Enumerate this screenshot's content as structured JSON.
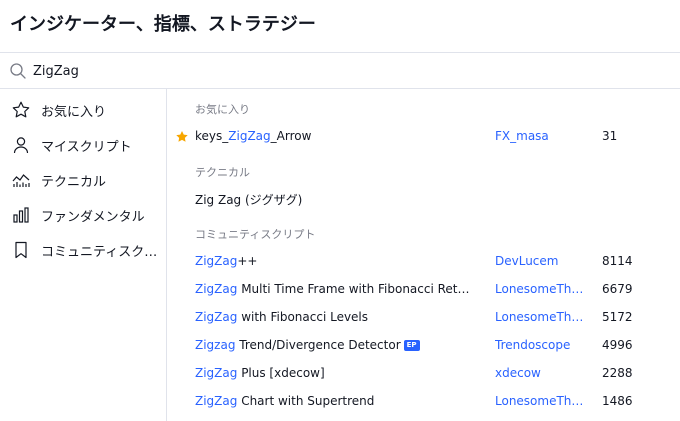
{
  "header": {
    "title": "インジケーター、指標、ストラテジー"
  },
  "search": {
    "value": "ZigZag"
  },
  "sidebar": {
    "items": [
      {
        "label": "お気に入り",
        "icon": "star-outline-icon"
      },
      {
        "label": "マイスクリプト",
        "icon": "user-icon"
      },
      {
        "label": "テクニカル",
        "icon": "technicals-chart-icon"
      },
      {
        "label": "ファンダメンタル",
        "icon": "bar-chart-icon"
      },
      {
        "label": "コミュニティスクリ...",
        "icon": "bookmark-icon"
      }
    ]
  },
  "sections": {
    "favorites": {
      "title": "お気に入り",
      "rows": [
        {
          "pre": "keys_",
          "hl": "ZigZag",
          "post": "_Arrow",
          "author": "FX_masa",
          "count": "31",
          "starred": true,
          "star_color": "#f7a600"
        }
      ]
    },
    "technicals": {
      "title": "テクニカル",
      "rows": [
        {
          "name": "Zig Zag (ジグザグ)"
        }
      ]
    },
    "community": {
      "title": "コミュニティスクリプト",
      "rows": [
        {
          "hl": "ZigZag",
          "post": "++",
          "author": "DevLucem",
          "count": "8114"
        },
        {
          "hl": "ZigZag",
          "post": " Multi Time Frame with Fibonacci Retrace...",
          "author": "LonesomeThe...",
          "count": "6679"
        },
        {
          "hl": "ZigZag",
          "post": " with Fibonacci Levels",
          "author": "LonesomeThe...",
          "count": "5172"
        },
        {
          "hl": "Zigzag",
          "post": " Trend/Divergence Detector",
          "badge": "EP",
          "author": "Trendoscope",
          "count": "4996"
        },
        {
          "hl": "ZigZag",
          "post": " Plus [xdecow]",
          "author": "xdecow",
          "count": "2288"
        },
        {
          "hl": "ZigZag",
          "post": " Chart with Supertrend",
          "author": "LonesomeThe...",
          "count": "1486"
        }
      ]
    }
  },
  "colors": {
    "accent": "#2962ff",
    "text": "#131722",
    "muted": "#787b86",
    "border": "#e0e3eb",
    "star": "#f7a600"
  }
}
